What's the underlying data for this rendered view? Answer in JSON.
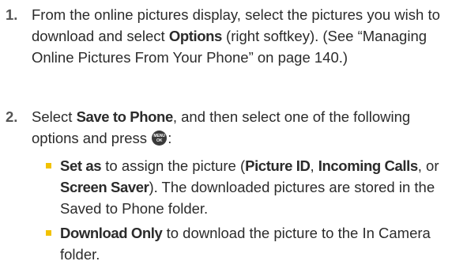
{
  "steps": [
    {
      "number": "1.",
      "t1": "From the online pictures display, select the pictures you wish to download and select ",
      "b1": "Options",
      "t2": " (right softkey). (See “Managing Online Pictures From Your Phone” on page 140.)"
    },
    {
      "number": "2.",
      "t1": "Select ",
      "b1": "Save to Phone",
      "t2": ", and then select one of the following options and press ",
      "t3": ":"
    }
  ],
  "menu_key": {
    "icon": "menu-ok-key-icon",
    "top": "MENU",
    "bottom": "OK"
  },
  "options": [
    {
      "b1": "Set as",
      "t1": " to assign the picture (",
      "b2": "Picture ID",
      "t2": ", ",
      "b3": "Incoming Calls",
      "t3": ", or ",
      "b4": "Screen Saver",
      "t4": "). The downloaded pictures are stored in the Saved to Phone folder."
    },
    {
      "b1": "Download Only",
      "t1": " to download the picture to the In Camera folder."
    }
  ],
  "colors": {
    "bullet": "#f2c200",
    "text": "#2b2b2b",
    "step_number": "#555555"
  }
}
